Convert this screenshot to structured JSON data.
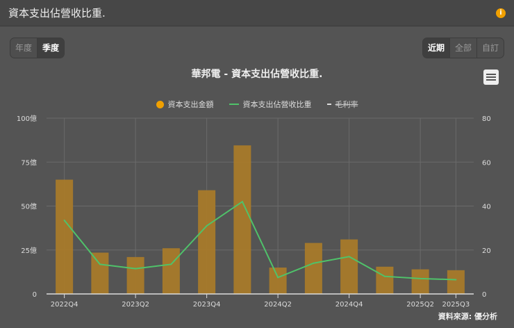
{
  "header": {
    "title": "資本支出佔營收比重.",
    "info_icon": "i"
  },
  "period_toggle": [
    "年度",
    "季度"
  ],
  "period_active": 1,
  "range_toggle": [
    "近期",
    "全部",
    "自訂"
  ],
  "range_active": 0,
  "colors": {
    "bar": "#a87a2a",
    "line": "#4fc36a",
    "accent": "#f0a000"
  },
  "chart_data": {
    "type": "bar",
    "title": "華邦電 - 資本支出佔營收比重.",
    "categories": [
      "2022Q4",
      "2023Q1",
      "2023Q2",
      "2023Q3",
      "2023Q4",
      "2024Q1",
      "2024Q2",
      "2024Q3",
      "2024Q4",
      "2025Q1",
      "2025Q2",
      "2025Q3"
    ],
    "x_tick_labels": [
      "2022Q4",
      "2023Q2",
      "2023Q4",
      "2024Q2",
      "2024Q4",
      "2025Q2",
      "2025Q3"
    ],
    "series": [
      {
        "name": "資本支出金額",
        "type": "bar",
        "axis": "left",
        "values": [
          65,
          23.5,
          21,
          26,
          59,
          84.5,
          15,
          29,
          31,
          15.5,
          14,
          13.5
        ]
      },
      {
        "name": "資本支出佔營收比重",
        "type": "line",
        "axis": "right",
        "values": [
          33.5,
          13.5,
          11.5,
          13.5,
          31,
          42,
          7.5,
          14,
          17,
          8,
          7,
          6.5
        ]
      },
      {
        "name": "毛利率",
        "type": "line",
        "hidden": true,
        "values": []
      }
    ],
    "left_axis": {
      "ylim": [
        0,
        100
      ],
      "ticks": [
        "0",
        "25億",
        "50億",
        "75億",
        "100億"
      ]
    },
    "right_axis": {
      "ylim": [
        0,
        80
      ],
      "ticks": [
        "0",
        "20",
        "40",
        "60",
        "80"
      ]
    },
    "legend_position": "top-center",
    "grid": true
  },
  "source": "資料來源: 優分析"
}
